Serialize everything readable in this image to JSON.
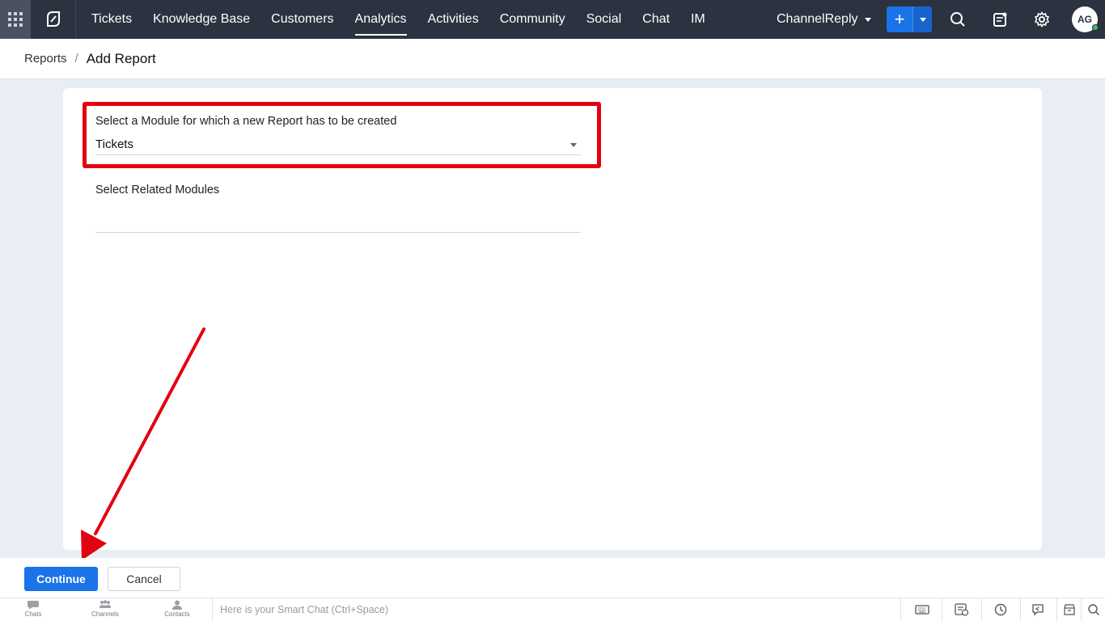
{
  "nav": {
    "items": [
      {
        "label": "Tickets",
        "active": false
      },
      {
        "label": "Knowledge Base",
        "active": false
      },
      {
        "label": "Customers",
        "active": false
      },
      {
        "label": "Analytics",
        "active": true
      },
      {
        "label": "Activities",
        "active": false
      },
      {
        "label": "Community",
        "active": false
      },
      {
        "label": "Social",
        "active": false
      },
      {
        "label": "Chat",
        "active": false
      },
      {
        "label": "IM",
        "active": false
      }
    ],
    "department": "ChannelReply",
    "add_label": "+",
    "avatar_initials": "AG",
    "icons": [
      "apps-grid-icon",
      "desk-logo-icon",
      "search-icon",
      "notes-icon",
      "gear-icon"
    ]
  },
  "breadcrumb": {
    "parent": "Reports",
    "separator": "/",
    "current": "Add Report"
  },
  "form": {
    "module_label": "Select a Module for which a new Report has to be created",
    "module_value": "Tickets",
    "related_label": "Select Related Modules",
    "related_value": ""
  },
  "actions": {
    "continue_label": "Continue",
    "cancel_label": "Cancel"
  },
  "chatbar": {
    "tabs": [
      {
        "label": "Chats",
        "icon": "chat-bubble-icon"
      },
      {
        "label": "Channels",
        "icon": "channels-icon"
      },
      {
        "label": "Contacts",
        "icon": "contact-icon"
      }
    ],
    "placeholder": "Here is your Smart Chat (Ctrl+Space)"
  },
  "colors": {
    "topbar": "#2b3240",
    "accent": "#1a73e8",
    "highlight": "#e3000f",
    "page_bg": "#e9edf4"
  }
}
